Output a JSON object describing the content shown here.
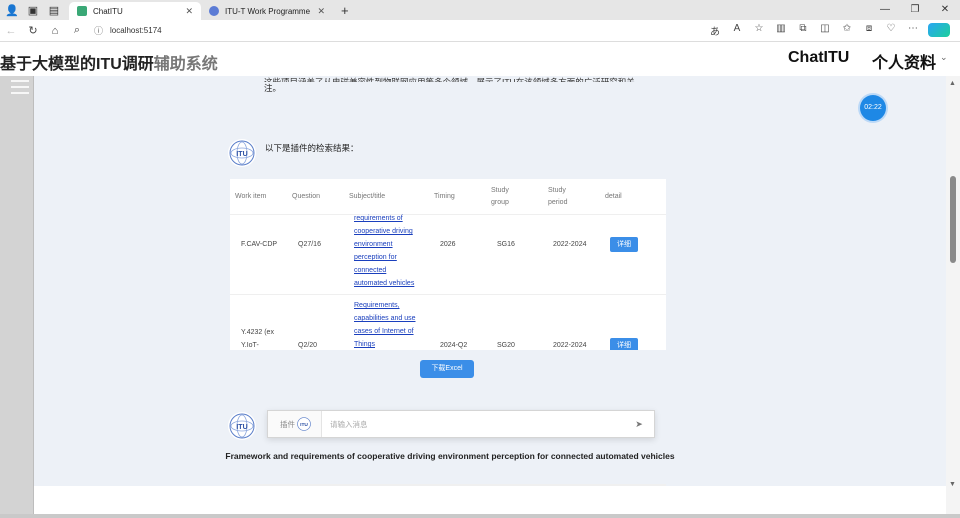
{
  "browser": {
    "tabs": [
      {
        "label": "ChatITU",
        "active": true
      },
      {
        "label": "ITU-T Work Programme",
        "active": false
      }
    ],
    "url": "localhost:5174",
    "favicon_colors": {
      "chatitu": "#3aa876",
      "itu": "#5b7bd5"
    }
  },
  "header": {
    "title_main": "基于大模型的ITU调研",
    "title_dim": "辅助系统",
    "brand": "ChatITU",
    "profile": "个人资料"
  },
  "chat": {
    "top_para_cut": "这些项目涵盖了从电磁兼容性到物联网应用等多个领域，展示了ITU在该领域多方面的广泛研究和关",
    "top_para_end": "注。",
    "timer": "02:22",
    "intro": "以下是插件的检索结果：",
    "table": {
      "headers": [
        "Work item",
        "Question",
        "Subject/title",
        "Timing",
        "Study group",
        "Study period",
        "detail"
      ],
      "rows": [
        {
          "work_item": "F.CAV-CDP",
          "question": "Q27/16",
          "subject": [
            "requirements of",
            "cooperative driving",
            "environment",
            "perception for",
            "connected",
            "automated vehicles"
          ],
          "timing": "2026",
          "study_group": "SG16",
          "study_period": "2022-2024",
          "detail": "详细"
        },
        {
          "work_item_lines": [
            "Y.4232 (ex",
            "Y.IoT-"
          ],
          "question": "Q2/20",
          "subject": [
            "Requirements,",
            "capabilities and use",
            "cases of Internet of",
            "Things"
          ],
          "timing": "2024-Q2",
          "study_group": "SG20",
          "study_period": "2022-2024",
          "detail": "详细"
        }
      ]
    },
    "download_label": "下载Excel",
    "input_plugin_label": "插件",
    "input_placeholder": "请输入消息",
    "result_title": "Framework and requirements of cooperative driving environment perception for connected automated vehicles"
  },
  "colors": {
    "accent": "#3b8ee8",
    "chat_bg": "#edf1f7",
    "sidebar": "#d3d3d3"
  }
}
